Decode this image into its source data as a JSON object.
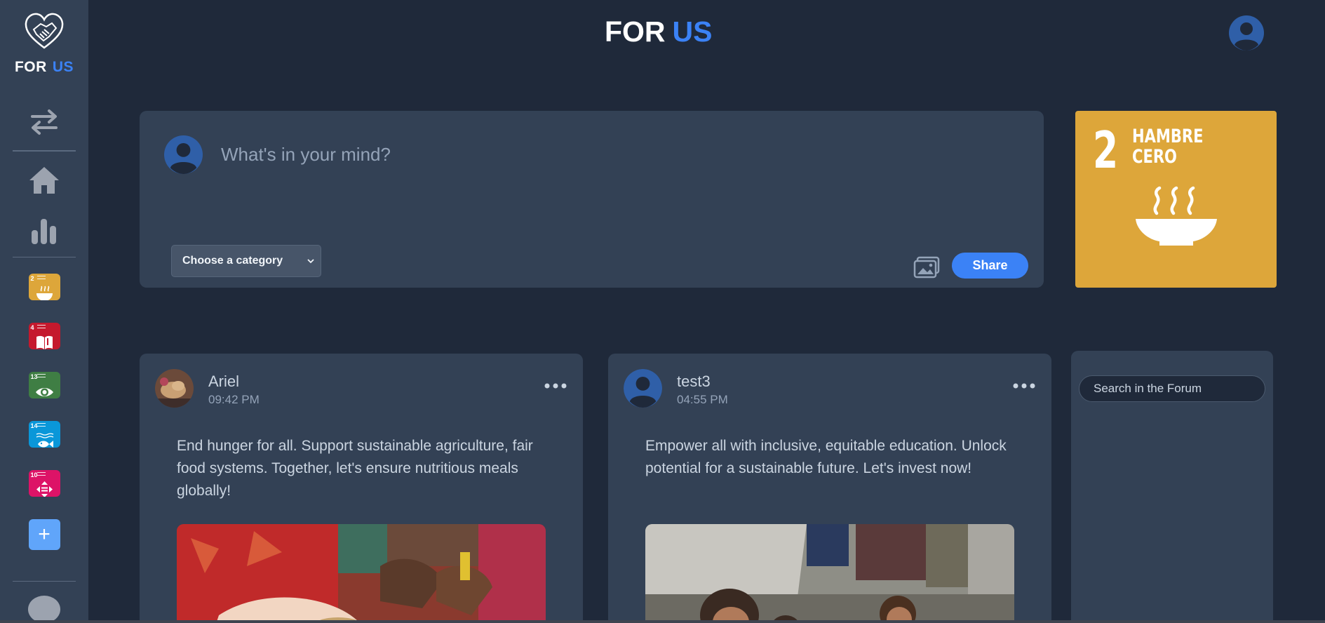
{
  "brand": {
    "name_part1": "FOR",
    "name_part2": "US"
  },
  "header": {
    "title_part1": "FOR",
    "title_part2": "US"
  },
  "sidebar": {
    "sdg_tiles": [
      {
        "number": "2",
        "color": "#dda63a",
        "icon": "bowl-icon"
      },
      {
        "number": "4",
        "color": "#c5192d",
        "icon": "book-icon"
      },
      {
        "number": "13",
        "color": "#3f7e44",
        "icon": "eye-globe-icon"
      },
      {
        "number": "14",
        "color": "#0a97d9",
        "icon": "fish-icon"
      },
      {
        "number": "10",
        "color": "#dd1367",
        "icon": "equality-icon"
      }
    ],
    "add_label": "+"
  },
  "composer": {
    "placeholder": "What's in your mind?",
    "category_label": "Choose a category",
    "share_label": "Share"
  },
  "sdg_card": {
    "number": "2",
    "title_line1": "HAMBRE",
    "title_line2": "CERO",
    "color": "#dda63a"
  },
  "posts": [
    {
      "author": "Ariel",
      "time": "09:42 PM",
      "text": "End hunger for all. Support sustainable agriculture, fair food systems. Together, let's ensure nutritious meals globally!"
    },
    {
      "author": "test3",
      "time": "04:55 PM",
      "text": "Empower all with inclusive, equitable education. Unlock potential for a sustainable future. Let's invest now!"
    }
  ],
  "forum": {
    "search_placeholder": "Search in the Forum"
  },
  "colors": {
    "accent": "#3b82f6",
    "background": "#1f293a",
    "panel": "#334155"
  }
}
